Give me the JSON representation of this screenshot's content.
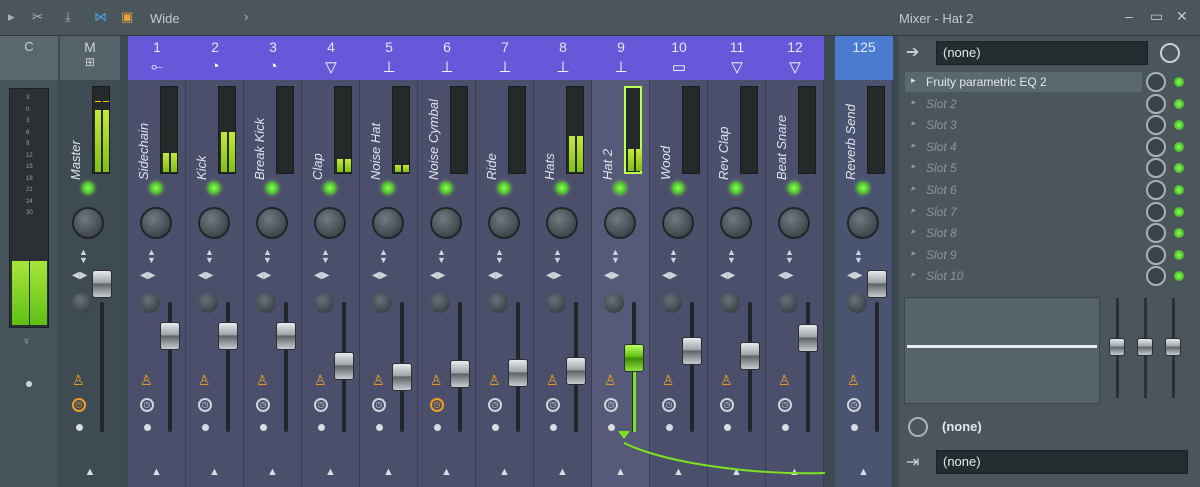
{
  "toolbar": {
    "preset": "Wide",
    "window_title": "Mixer - Hat 2"
  },
  "left": {
    "current_label": "C",
    "master_label": "M"
  },
  "meter_scale": [
    "3",
    "0",
    "3",
    "6",
    "9",
    "12",
    "15",
    "18",
    "21",
    "24",
    "30"
  ],
  "tracks": [
    {
      "num": "1",
      "name": "Sidechain",
      "icon": "sidechain-icon",
      "glyph": "⟜",
      "level": 0.22,
      "fader": 0.82
    },
    {
      "num": "2",
      "name": "Kick",
      "icon": "kick-icon",
      "glyph": "◔",
      "level": 0.47,
      "fader": 0.82
    },
    {
      "num": "3",
      "name": "Break Kick",
      "icon": "break-kick-icon",
      "glyph": "◔",
      "level": 0.0,
      "fader": 0.82
    },
    {
      "num": "4",
      "name": "Clap",
      "icon": "clap-icon",
      "glyph": "▽",
      "level": 0.15,
      "fader": 0.55
    },
    {
      "num": "5",
      "name": "Noise Hat",
      "icon": "noise-hat-icon",
      "glyph": "⊥",
      "level": 0.08,
      "fader": 0.45
    },
    {
      "num": "6",
      "name": "Noise Cymbal",
      "icon": "noise-cymbal-icon",
      "glyph": "⊥",
      "level": 0.0,
      "fader": 0.47
    },
    {
      "num": "7",
      "name": "Ride",
      "icon": "ride-icon",
      "glyph": "⊥",
      "level": 0.0,
      "fader": 0.48
    },
    {
      "num": "8",
      "name": "Hats",
      "icon": "hats-icon",
      "glyph": "⊥",
      "level": 0.42,
      "fader": 0.5
    },
    {
      "num": "9",
      "name": "Hat 2",
      "icon": "hat2-icon",
      "glyph": "⊥",
      "level": 0.25,
      "fader": 0.62
    },
    {
      "num": "10",
      "name": "Wood",
      "icon": "wood-icon",
      "glyph": "▭",
      "level": 0.0,
      "fader": 0.68
    },
    {
      "num": "11",
      "name": "Rev Clap",
      "icon": "rev-clap-icon",
      "glyph": "▽",
      "level": 0.0,
      "fader": 0.64
    },
    {
      "num": "12",
      "name": "Beat Snare",
      "icon": "beat-snare-icon",
      "glyph": "▽",
      "level": 0.0,
      "fader": 0.8
    }
  ],
  "send": {
    "num": "125",
    "name": "Reverb Send",
    "level": 0.0,
    "fader": 0.82
  },
  "master": {
    "name": "Master",
    "level": 0.7,
    "fader": 0.82
  },
  "right_panel": {
    "input": "(none)",
    "slots": [
      "Fruity parametric EQ 2",
      "Slot 2",
      "Slot 3",
      "Slot 4",
      "Slot 5",
      "Slot 6",
      "Slot 7",
      "Slot 8",
      "Slot 9",
      "Slot 10"
    ],
    "sidechain": "(none)",
    "output": "(none)"
  }
}
